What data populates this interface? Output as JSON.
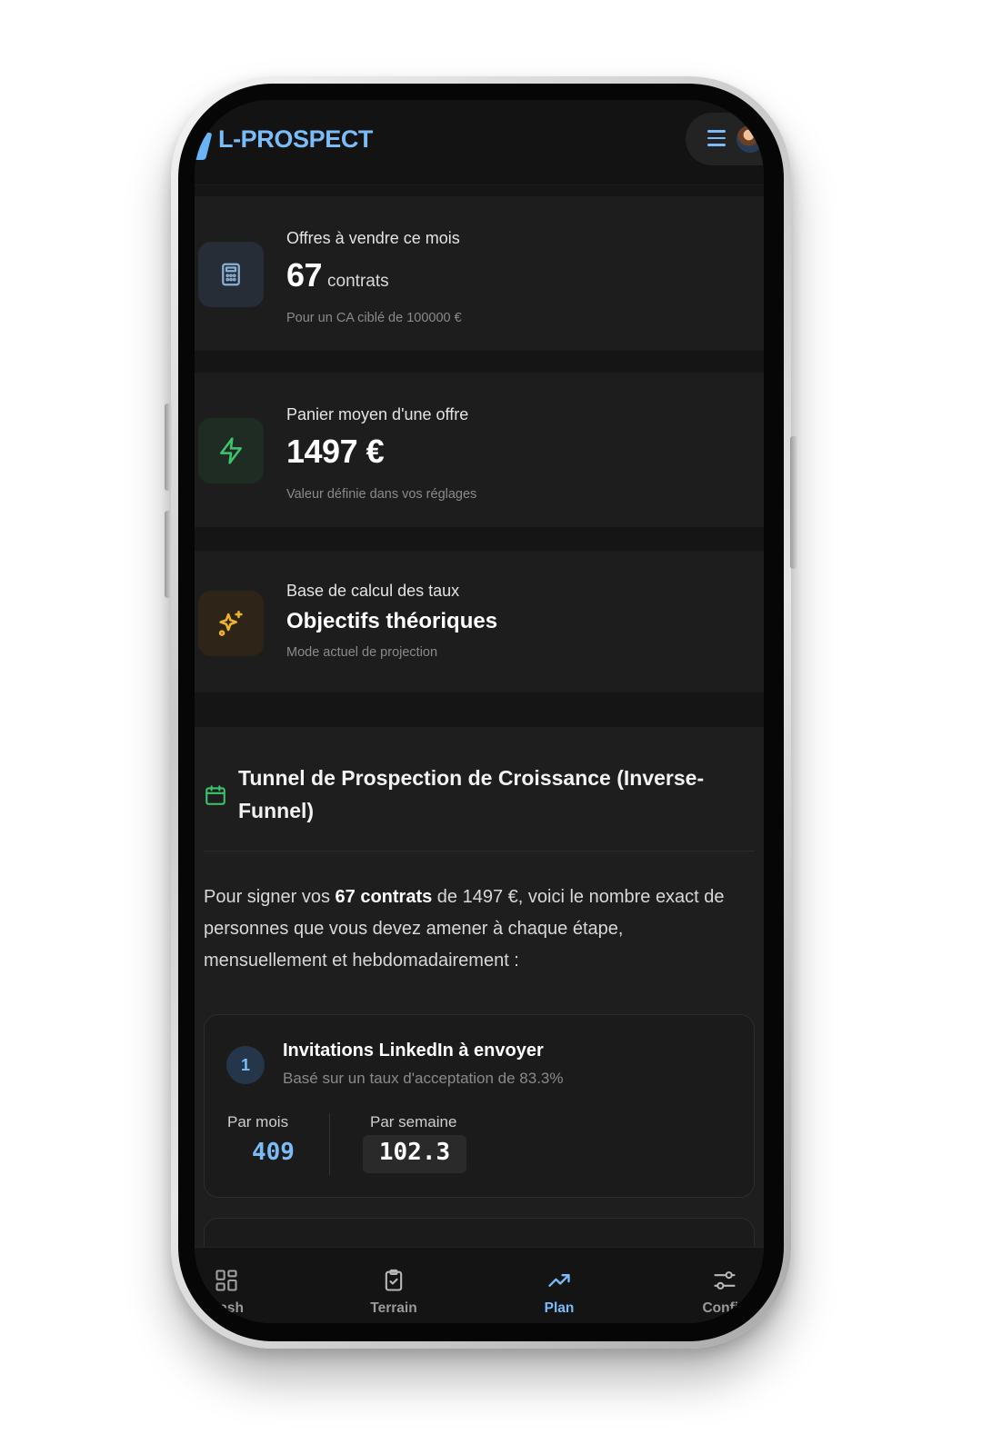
{
  "header": {
    "logo": "L-PROSPECT"
  },
  "stats": [
    {
      "label": "Offres à vendre ce mois",
      "value": "67",
      "unit": "contrats",
      "note": "Pour un CA ciblé de 100000 €",
      "icon": "calculator-icon"
    },
    {
      "label": "Panier moyen d'une offre",
      "value": "1497 €",
      "note": "Valeur définie dans vos réglages",
      "icon": "lightning-icon"
    },
    {
      "label": "Base de calcul des taux",
      "value": "Objectifs théoriques",
      "note": "Mode actuel de projection",
      "icon": "sparkles-icon"
    }
  ],
  "funnel": {
    "title": "Tunnel de Prospection de Croissance (Inverse-Funnel)",
    "intro_prefix": "Pour signer vos ",
    "intro_bold": "67 contrats",
    "intro_suffix": " de 1497 €, voici le nombre exact de personnes que vous devez amener à chaque étape, mensuellement et hebdomadairement :",
    "steps": [
      {
        "number": "1",
        "title": "Invitations LinkedIn à envoyer",
        "subtitle": "Basé sur un taux d'acceptation de 83.3%",
        "month_label": "Par mois",
        "month_value": "409",
        "week_label": "Par semaine",
        "week_value": "102.3"
      }
    ]
  },
  "nav": [
    {
      "label": "Dash",
      "icon": "dashboard-icon"
    },
    {
      "label": "Terrain",
      "icon": "clipboard-check-icon"
    },
    {
      "label": "Plan",
      "icon": "trending-up-icon",
      "active": true
    },
    {
      "label": "Config",
      "icon": "sliders-icon"
    }
  ],
  "colors": {
    "accent": "#7bbcf8",
    "background": "#151515",
    "card": "#1d1d1d",
    "green": "#3ec46d",
    "amber": "#f0b429"
  }
}
